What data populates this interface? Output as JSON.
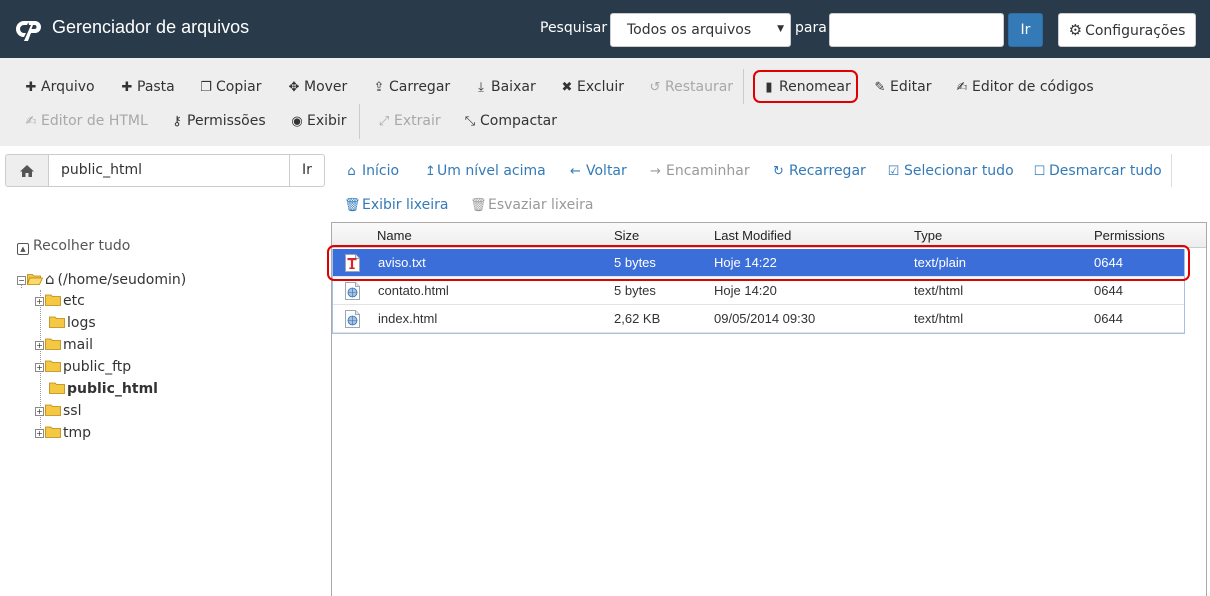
{
  "header": {
    "title": "Gerenciador de arquivos",
    "search_label": "Pesquisar",
    "search_scope": "Todos os arquivos",
    "for_label": "para",
    "search_value": "",
    "search_go": "Ir",
    "settings_label": "Configurações"
  },
  "toolbar": {
    "row1": [
      {
        "label": "Arquivo",
        "icon": "plus-icon",
        "enabled": true
      },
      {
        "label": "Pasta",
        "icon": "plus-icon",
        "enabled": true
      },
      {
        "label": "Copiar",
        "icon": "copy-icon",
        "enabled": true
      },
      {
        "label": "Mover",
        "icon": "move-icon",
        "enabled": true
      },
      {
        "label": "Carregar",
        "icon": "upload-icon",
        "enabled": true
      },
      {
        "label": "Baixar",
        "icon": "download-icon",
        "enabled": true
      },
      {
        "label": "Excluir",
        "icon": "close-icon",
        "enabled": true
      },
      {
        "label": "Restaurar",
        "icon": "undo-icon",
        "enabled": false
      },
      {
        "label": "Renomear",
        "icon": "file-icon",
        "enabled": true
      },
      {
        "label": "Editar",
        "icon": "pencil-icon",
        "enabled": true
      },
      {
        "label": "Editor de códigos",
        "icon": "edit-icon",
        "enabled": true
      }
    ],
    "row2": [
      {
        "label": "Editor de HTML",
        "icon": "edit-icon",
        "enabled": false
      },
      {
        "label": "Permissões",
        "icon": "key-icon",
        "enabled": true
      },
      {
        "label": "Exibir",
        "icon": "eye-icon",
        "enabled": true
      },
      {
        "label": "Extrair",
        "icon": "expand-icon",
        "enabled": false
      },
      {
        "label": "Compactar",
        "icon": "compress-icon",
        "enabled": true
      }
    ]
  },
  "path": {
    "value": "public_html",
    "go_label": "Ir"
  },
  "nav": {
    "row1": [
      {
        "label": "Início",
        "icon": "home-icon",
        "enabled": true
      },
      {
        "label": "Um nível acima",
        "icon": "level-up-icon",
        "enabled": true
      },
      {
        "label": "Voltar",
        "icon": "arrow-left-icon",
        "enabled": true
      },
      {
        "label": "Encaminhar",
        "icon": "arrow-right-icon",
        "enabled": false
      },
      {
        "label": "Recarregar",
        "icon": "refresh-icon",
        "enabled": true
      },
      {
        "label": "Selecionar tudo",
        "icon": "checkbox-checked-icon",
        "enabled": true
      },
      {
        "label": "Desmarcar tudo",
        "icon": "checkbox-empty-icon",
        "enabled": true
      }
    ],
    "row2": [
      {
        "label": "Exibir lixeira",
        "icon": "trash-icon",
        "enabled": true
      },
      {
        "label": "Esvaziar lixeira",
        "icon": "trash-icon",
        "enabled": false
      }
    ]
  },
  "tree": {
    "collapse_label": "Recolher tudo",
    "root_label": "(/home/seudomin)",
    "items": [
      {
        "label": "etc",
        "expandable": true,
        "current": false
      },
      {
        "label": "logs",
        "expandable": false,
        "current": false
      },
      {
        "label": "mail",
        "expandable": true,
        "current": false
      },
      {
        "label": "public_ftp",
        "expandable": true,
        "current": false
      },
      {
        "label": "public_html",
        "expandable": false,
        "current": true
      },
      {
        "label": "ssl",
        "expandable": true,
        "current": false
      },
      {
        "label": "tmp",
        "expandable": true,
        "current": false
      }
    ]
  },
  "files": {
    "columns": [
      "Name",
      "Size",
      "Last Modified",
      "Type",
      "Permissions"
    ],
    "rows": [
      {
        "name": "aviso.txt",
        "size": "5 bytes",
        "modified": "Hoje 14:22",
        "type": "text/plain",
        "perms": "0644",
        "icon": "text-file-icon",
        "selected": true
      },
      {
        "name": "contato.html",
        "size": "5 bytes",
        "modified": "Hoje 14:20",
        "type": "text/html",
        "perms": "0644",
        "icon": "html-file-icon",
        "selected": false
      },
      {
        "name": "index.html",
        "size": "2,62 KB",
        "modified": "09/05/2014 09:30",
        "type": "text/html",
        "perms": "0644",
        "icon": "html-file-icon",
        "selected": false
      }
    ]
  },
  "colors": {
    "header_bg": "#293a4a",
    "accent": "#337ab7",
    "selected_row": "#3b6ed8",
    "highlight": "#e10000"
  }
}
